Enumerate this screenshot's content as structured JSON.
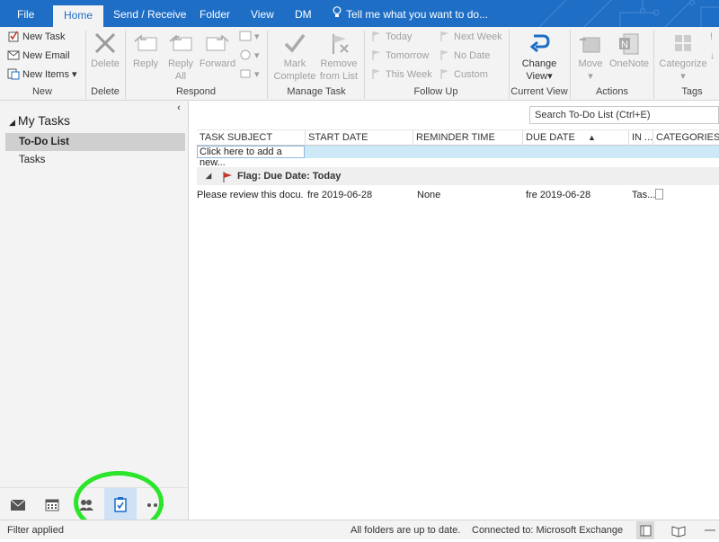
{
  "tabs": [
    {
      "label": "File"
    },
    {
      "label": "Home"
    },
    {
      "label": "Send / Receive"
    },
    {
      "label": "Folder"
    },
    {
      "label": "View"
    },
    {
      "label": "DM"
    }
  ],
  "tell_me": "Tell me what you want to do...",
  "ribbon": {
    "new": {
      "new_task": "New Task",
      "new_email": "New Email",
      "new_items": "New Items",
      "label": "New"
    },
    "delete": {
      "button": "Delete",
      "label": "Delete"
    },
    "respond": {
      "reply": "Reply",
      "reply_all_1": "Reply",
      "reply_all_2": "All",
      "forward": "Forward",
      "label": "Respond"
    },
    "manage": {
      "mark_1": "Mark",
      "mark_2": "Complete",
      "remove_1": "Remove",
      "remove_2": "from List",
      "label": "Manage Task"
    },
    "follow": {
      "today": "Today",
      "tomorrow": "Tomorrow",
      "this_week": "This Week",
      "next_week": "Next Week",
      "no_date": "No Date",
      "custom": "Custom",
      "label": "Follow Up"
    },
    "view": {
      "change_1": "Change",
      "change_2": "View",
      "label": "Current View"
    },
    "actions": {
      "move": "Move",
      "onenote": "OneNote",
      "label": "Actions"
    },
    "tags": {
      "categorize": "Categorize",
      "label": "Tags"
    }
  },
  "nav": {
    "header": "My Tasks",
    "items": [
      {
        "label": "To-Do List"
      },
      {
        "label": "Tasks"
      }
    ]
  },
  "search": {
    "placeholder": "Search To-Do List (Ctrl+E)"
  },
  "columns": [
    "TASK SUBJECT",
    "START DATE",
    "REMINDER TIME",
    "DUE DATE",
    "IN ...",
    "CATEGORIES"
  ],
  "new_item_prompt": "Click here to add a new...",
  "group": {
    "label": "Flag: Due Date: Today"
  },
  "rows": [
    {
      "subject": "Please review this docu...",
      "start": "fre 2019-06-28",
      "reminder": "None",
      "due": "fre 2019-06-28",
      "in": "Tas..."
    }
  ],
  "status": {
    "filter": "Filter applied",
    "sync": "All folders are up to date.",
    "connection": "Connected to: Microsoft Exchange"
  },
  "colors": {
    "accent": "#1e6ec6",
    "ribbon_bg": "#f3f3f3",
    "highlight": "#2ae52a",
    "flag": "#c0392b"
  }
}
